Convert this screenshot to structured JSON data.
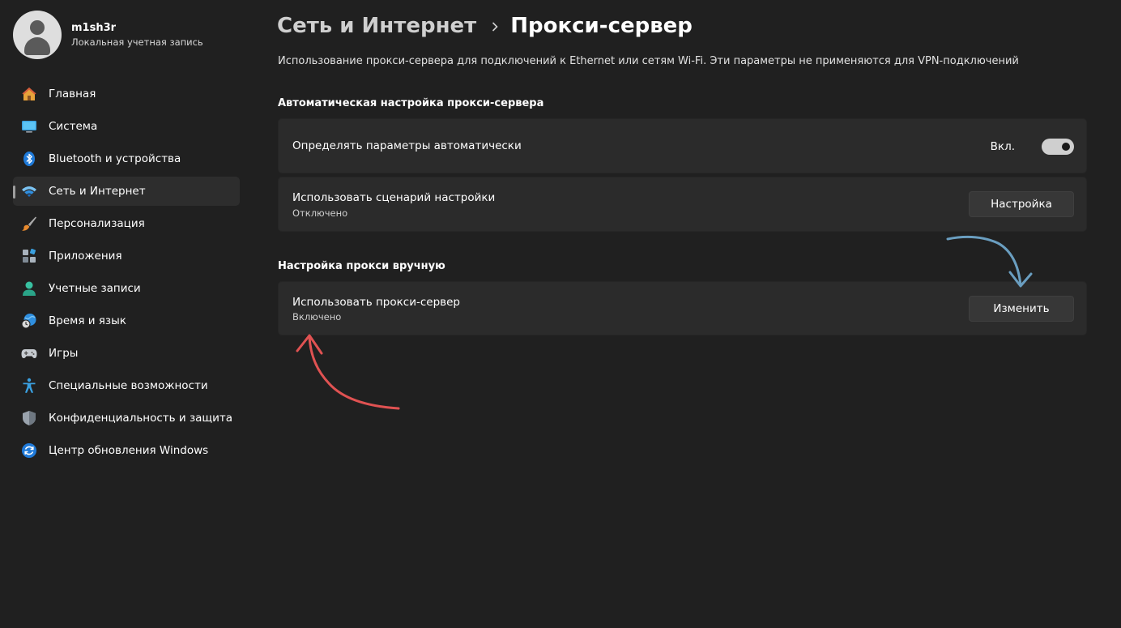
{
  "user": {
    "name": "m1sh3r",
    "account_type": "Локальная учетная запись"
  },
  "nav": {
    "items": [
      {
        "label": "Главная",
        "icon": "home-icon"
      },
      {
        "label": "Система",
        "icon": "monitor-icon"
      },
      {
        "label": "Bluetooth и устройства",
        "icon": "bluetooth-icon"
      },
      {
        "label": "Сеть и Интернет",
        "icon": "wifi-icon",
        "active": true
      },
      {
        "label": "Персонализация",
        "icon": "brush-icon"
      },
      {
        "label": "Приложения",
        "icon": "apps-icon"
      },
      {
        "label": "Учетные записи",
        "icon": "person-icon"
      },
      {
        "label": "Время и язык",
        "icon": "globe-clock-icon"
      },
      {
        "label": "Игры",
        "icon": "gamepad-icon"
      },
      {
        "label": "Специальные возможности",
        "icon": "accessibility-icon"
      },
      {
        "label": "Конфиденциальность и защита",
        "icon": "shield-icon"
      },
      {
        "label": "Центр обновления Windows",
        "icon": "update-icon"
      }
    ]
  },
  "breadcrumb": {
    "parent": "Сеть и Интернет",
    "current": "Прокси-сервер"
  },
  "description": "Использование прокси-сервера для подключений к Ethernet или сетям Wi-Fi. Эти параметры не применяются для VPN-подключений",
  "auto_section": {
    "title": "Автоматическая настройка прокси-сервера",
    "detect": {
      "title": "Определять параметры автоматически",
      "state_label": "Вкл.",
      "enabled": true
    },
    "script": {
      "title": "Использовать сценарий настройки",
      "status": "Отключено",
      "button": "Настройка"
    }
  },
  "manual_section": {
    "title": "Настройка прокси вручную",
    "proxy": {
      "title": "Использовать прокси-сервер",
      "status": "Включено",
      "button": "Изменить"
    }
  },
  "colors": {
    "background": "#202020",
    "card": "#2b2b2b",
    "accent": "#0078d4",
    "annotation_blue": "#6a9ec0",
    "annotation_red": "#e05252"
  }
}
